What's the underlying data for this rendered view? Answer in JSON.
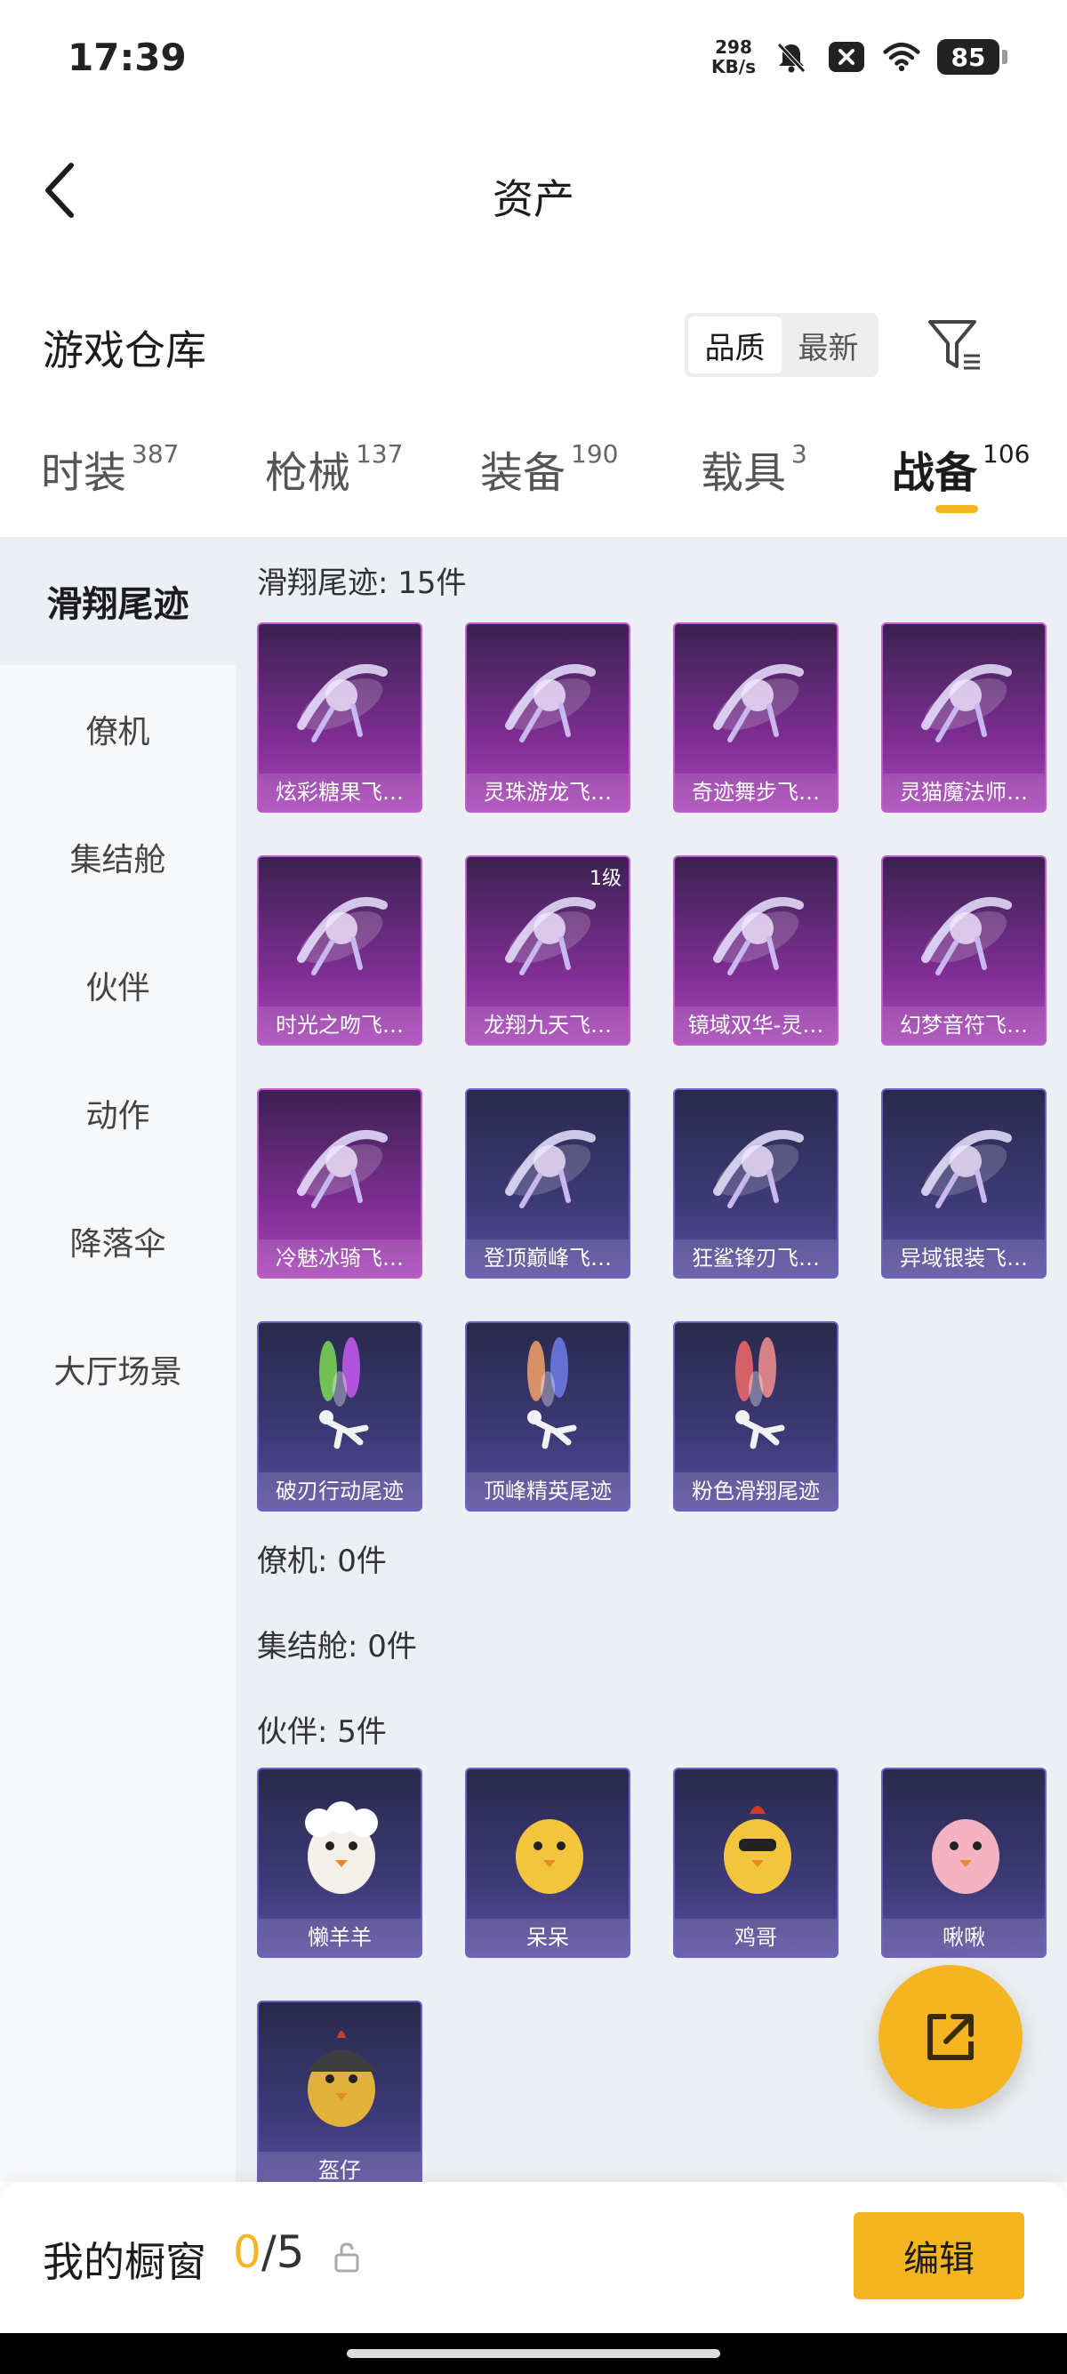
{
  "status": {
    "time": "17:39",
    "net_speed_value": "298",
    "net_speed_unit": "KB/s",
    "battery": "85"
  },
  "header": {
    "title": "资产"
  },
  "warehouse": {
    "title": "游戏仓库",
    "sort_options": [
      "品质",
      "最新"
    ],
    "active_sort": "品质"
  },
  "tabs": [
    {
      "label": "时装",
      "count": "387"
    },
    {
      "label": "枪械",
      "count": "137"
    },
    {
      "label": "装备",
      "count": "190"
    },
    {
      "label": "载具",
      "count": "3"
    },
    {
      "label": "战备",
      "count": "106"
    }
  ],
  "active_tab": "战备",
  "sidebar": [
    "滑翔尾迹",
    "僚机",
    "集结舱",
    "伙伴",
    "动作",
    "降落伞",
    "大厅场景"
  ],
  "active_sidebar": "滑翔尾迹",
  "sections": [
    {
      "title": "滑翔尾迹: 15件",
      "items": [
        {
          "name": "炫彩糖果飞…",
          "rarity": "purple",
          "icon": "candy-glider-icon"
        },
        {
          "name": "灵珠游龙飞…",
          "rarity": "purple",
          "icon": "dragon-glider-icon"
        },
        {
          "name": "奇迹舞步飞…",
          "rarity": "purple",
          "icon": "trident-glider-icon"
        },
        {
          "name": "灵猫魔法师…",
          "rarity": "purple",
          "icon": "cat-glider-icon"
        },
        {
          "name": "时光之吻飞…",
          "rarity": "purple",
          "icon": "hourglass-glider-icon"
        },
        {
          "name": "龙翔九天飞…",
          "rarity": "purple",
          "icon": "black-dragon-glider-icon",
          "level": "1级"
        },
        {
          "name": "镜域双华-灵…",
          "rarity": "purple",
          "icon": "crystal-glider-icon"
        },
        {
          "name": "幻梦音符飞…",
          "rarity": "purple",
          "icon": "music-box-glider-icon"
        },
        {
          "name": "冷魅冰骑飞…",
          "rarity": "purple",
          "icon": "ice-wing-glider-icon"
        },
        {
          "name": "登顶巅峰飞…",
          "rarity": "blue",
          "icon": "jet-glider-icon"
        },
        {
          "name": "狂鲨锋刃飞…",
          "rarity": "blue",
          "icon": "shark-glider-icon"
        },
        {
          "name": "异域银装飞…",
          "rarity": "blue",
          "icon": "bat-wing-glider-icon"
        },
        {
          "name": "破刃行动尾迹",
          "rarity": "blue",
          "icon": "smoke-trail-icon",
          "smoke": [
            "#7ed957",
            "#c85bf0"
          ]
        },
        {
          "name": "顶峰精英尾迹",
          "rarity": "blue",
          "icon": "smoke-trail-icon",
          "smoke": [
            "#f3a16a",
            "#6f7de8"
          ]
        },
        {
          "name": "粉色滑翔尾迹",
          "rarity": "blue",
          "icon": "smoke-trail-icon",
          "smoke": [
            "#f26a6a",
            "#f49090"
          ]
        }
      ]
    },
    {
      "title": "僚机: 0件",
      "items": []
    },
    {
      "title": "集结舱: 0件",
      "items": []
    },
    {
      "title": "伙伴: 5件",
      "items": [
        {
          "name": "懒羊羊",
          "rarity": "blue",
          "icon": "sheep-companion-icon"
        },
        {
          "name": "呆呆",
          "rarity": "blue",
          "icon": "chick-companion-icon"
        },
        {
          "name": "鸡哥",
          "rarity": "blue",
          "icon": "rooster-companion-icon"
        },
        {
          "name": "啾啾",
          "rarity": "blue",
          "icon": "bird-companion-icon"
        },
        {
          "name": "盔仔",
          "rarity": "blue",
          "icon": "helmet-chick-companion-icon"
        }
      ]
    }
  ],
  "showcase": {
    "label": "我的橱窗",
    "used": "0",
    "separator": "/",
    "total": "5",
    "edit_label": "编辑"
  },
  "colors": {
    "accent": "#f5b521",
    "purple_card": "#7e2e93",
    "blue_card": "#3e3a78"
  }
}
